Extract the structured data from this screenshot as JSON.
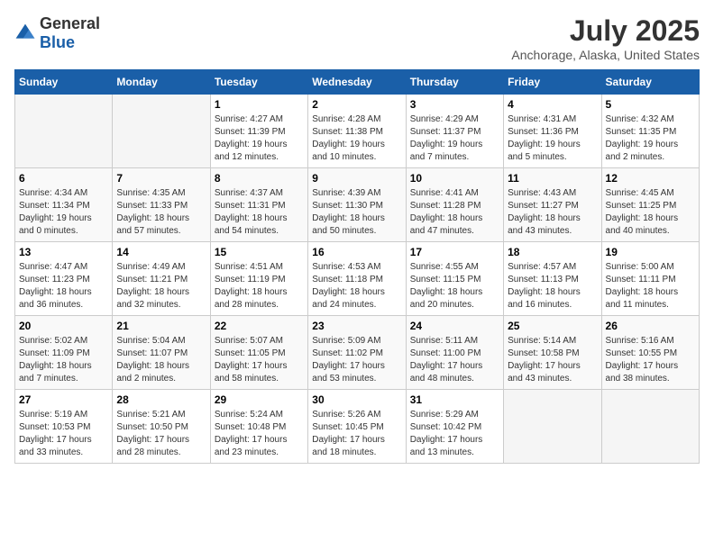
{
  "header": {
    "logo_general": "General",
    "logo_blue": "Blue",
    "month_year": "July 2025",
    "location": "Anchorage, Alaska, United States"
  },
  "weekdays": [
    "Sunday",
    "Monday",
    "Tuesday",
    "Wednesday",
    "Thursday",
    "Friday",
    "Saturday"
  ],
  "weeks": [
    [
      {
        "day": "",
        "detail": ""
      },
      {
        "day": "",
        "detail": ""
      },
      {
        "day": "1",
        "detail": "Sunrise: 4:27 AM\nSunset: 11:39 PM\nDaylight: 19 hours\nand 12 minutes."
      },
      {
        "day": "2",
        "detail": "Sunrise: 4:28 AM\nSunset: 11:38 PM\nDaylight: 19 hours\nand 10 minutes."
      },
      {
        "day": "3",
        "detail": "Sunrise: 4:29 AM\nSunset: 11:37 PM\nDaylight: 19 hours\nand 7 minutes."
      },
      {
        "day": "4",
        "detail": "Sunrise: 4:31 AM\nSunset: 11:36 PM\nDaylight: 19 hours\nand 5 minutes."
      },
      {
        "day": "5",
        "detail": "Sunrise: 4:32 AM\nSunset: 11:35 PM\nDaylight: 19 hours\nand 2 minutes."
      }
    ],
    [
      {
        "day": "6",
        "detail": "Sunrise: 4:34 AM\nSunset: 11:34 PM\nDaylight: 19 hours\nand 0 minutes."
      },
      {
        "day": "7",
        "detail": "Sunrise: 4:35 AM\nSunset: 11:33 PM\nDaylight: 18 hours\nand 57 minutes."
      },
      {
        "day": "8",
        "detail": "Sunrise: 4:37 AM\nSunset: 11:31 PM\nDaylight: 18 hours\nand 54 minutes."
      },
      {
        "day": "9",
        "detail": "Sunrise: 4:39 AM\nSunset: 11:30 PM\nDaylight: 18 hours\nand 50 minutes."
      },
      {
        "day": "10",
        "detail": "Sunrise: 4:41 AM\nSunset: 11:28 PM\nDaylight: 18 hours\nand 47 minutes."
      },
      {
        "day": "11",
        "detail": "Sunrise: 4:43 AM\nSunset: 11:27 PM\nDaylight: 18 hours\nand 43 minutes."
      },
      {
        "day": "12",
        "detail": "Sunrise: 4:45 AM\nSunset: 11:25 PM\nDaylight: 18 hours\nand 40 minutes."
      }
    ],
    [
      {
        "day": "13",
        "detail": "Sunrise: 4:47 AM\nSunset: 11:23 PM\nDaylight: 18 hours\nand 36 minutes."
      },
      {
        "day": "14",
        "detail": "Sunrise: 4:49 AM\nSunset: 11:21 PM\nDaylight: 18 hours\nand 32 minutes."
      },
      {
        "day": "15",
        "detail": "Sunrise: 4:51 AM\nSunset: 11:19 PM\nDaylight: 18 hours\nand 28 minutes."
      },
      {
        "day": "16",
        "detail": "Sunrise: 4:53 AM\nSunset: 11:18 PM\nDaylight: 18 hours\nand 24 minutes."
      },
      {
        "day": "17",
        "detail": "Sunrise: 4:55 AM\nSunset: 11:15 PM\nDaylight: 18 hours\nand 20 minutes."
      },
      {
        "day": "18",
        "detail": "Sunrise: 4:57 AM\nSunset: 11:13 PM\nDaylight: 18 hours\nand 16 minutes."
      },
      {
        "day": "19",
        "detail": "Sunrise: 5:00 AM\nSunset: 11:11 PM\nDaylight: 18 hours\nand 11 minutes."
      }
    ],
    [
      {
        "day": "20",
        "detail": "Sunrise: 5:02 AM\nSunset: 11:09 PM\nDaylight: 18 hours\nand 7 minutes."
      },
      {
        "day": "21",
        "detail": "Sunrise: 5:04 AM\nSunset: 11:07 PM\nDaylight: 18 hours\nand 2 minutes."
      },
      {
        "day": "22",
        "detail": "Sunrise: 5:07 AM\nSunset: 11:05 PM\nDaylight: 17 hours\nand 58 minutes."
      },
      {
        "day": "23",
        "detail": "Sunrise: 5:09 AM\nSunset: 11:02 PM\nDaylight: 17 hours\nand 53 minutes."
      },
      {
        "day": "24",
        "detail": "Sunrise: 5:11 AM\nSunset: 11:00 PM\nDaylight: 17 hours\nand 48 minutes."
      },
      {
        "day": "25",
        "detail": "Sunrise: 5:14 AM\nSunset: 10:58 PM\nDaylight: 17 hours\nand 43 minutes."
      },
      {
        "day": "26",
        "detail": "Sunrise: 5:16 AM\nSunset: 10:55 PM\nDaylight: 17 hours\nand 38 minutes."
      }
    ],
    [
      {
        "day": "27",
        "detail": "Sunrise: 5:19 AM\nSunset: 10:53 PM\nDaylight: 17 hours\nand 33 minutes."
      },
      {
        "day": "28",
        "detail": "Sunrise: 5:21 AM\nSunset: 10:50 PM\nDaylight: 17 hours\nand 28 minutes."
      },
      {
        "day": "29",
        "detail": "Sunrise: 5:24 AM\nSunset: 10:48 PM\nDaylight: 17 hours\nand 23 minutes."
      },
      {
        "day": "30",
        "detail": "Sunrise: 5:26 AM\nSunset: 10:45 PM\nDaylight: 17 hours\nand 18 minutes."
      },
      {
        "day": "31",
        "detail": "Sunrise: 5:29 AM\nSunset: 10:42 PM\nDaylight: 17 hours\nand 13 minutes."
      },
      {
        "day": "",
        "detail": ""
      },
      {
        "day": "",
        "detail": ""
      }
    ]
  ]
}
